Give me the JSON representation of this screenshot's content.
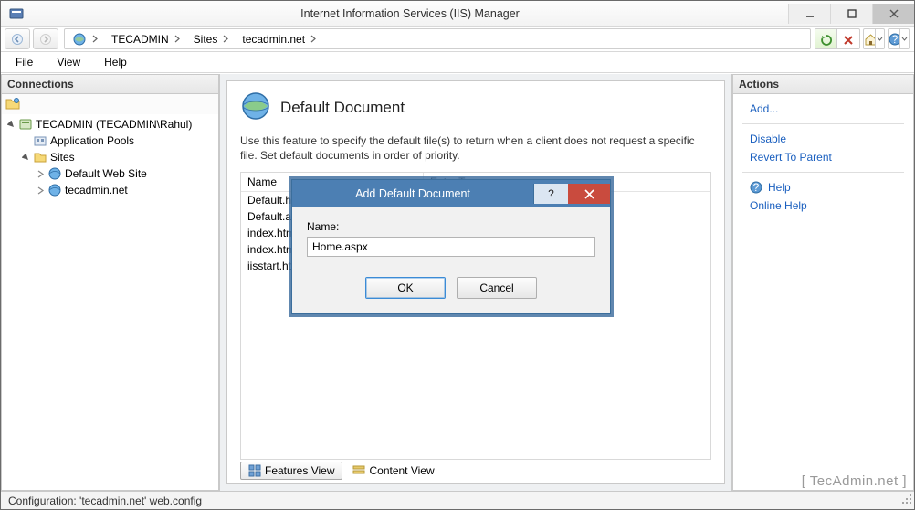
{
  "window": {
    "title": "Internet Information Services (IIS) Manager"
  },
  "breadcrumb": {
    "node0": "TECADMIN",
    "node1": "Sites",
    "node2": "tecadmin.net"
  },
  "menu": {
    "file": "File",
    "view": "View",
    "help": "Help"
  },
  "connections": {
    "title": "Connections",
    "root": "TECADMIN (TECADMIN\\Rahul)",
    "pools": "Application Pools",
    "sites": "Sites",
    "site_default": "Default Web Site",
    "site_tecadmin": "tecadmin.net"
  },
  "feature": {
    "heading": "Default Document",
    "description": "Use this feature to specify the default file(s) to return when a client does not request a specific file. Set default documents in order of priority.",
    "col_name": "Name",
    "col_type": "Entry Type",
    "rows": {
      "r0": "Default.htm",
      "r1": "Default.asp",
      "r2": "index.htm",
      "r3": "index.html",
      "r4": "iisstart.htm"
    }
  },
  "view_tabs": {
    "features": "Features View",
    "content": "Content View"
  },
  "actions": {
    "title": "Actions",
    "add": "Add...",
    "disable": "Disable",
    "revert": "Revert To Parent",
    "help": "Help",
    "online_help": "Online Help"
  },
  "dialog": {
    "title": "Add Default Document",
    "name_label": "Name:",
    "name_value": "Home.aspx",
    "ok": "OK",
    "cancel": "Cancel",
    "help_glyph": "?"
  },
  "status": {
    "config": "Configuration: 'tecadmin.net' web.config"
  },
  "watermark": "[ TecAdmin.net ]"
}
